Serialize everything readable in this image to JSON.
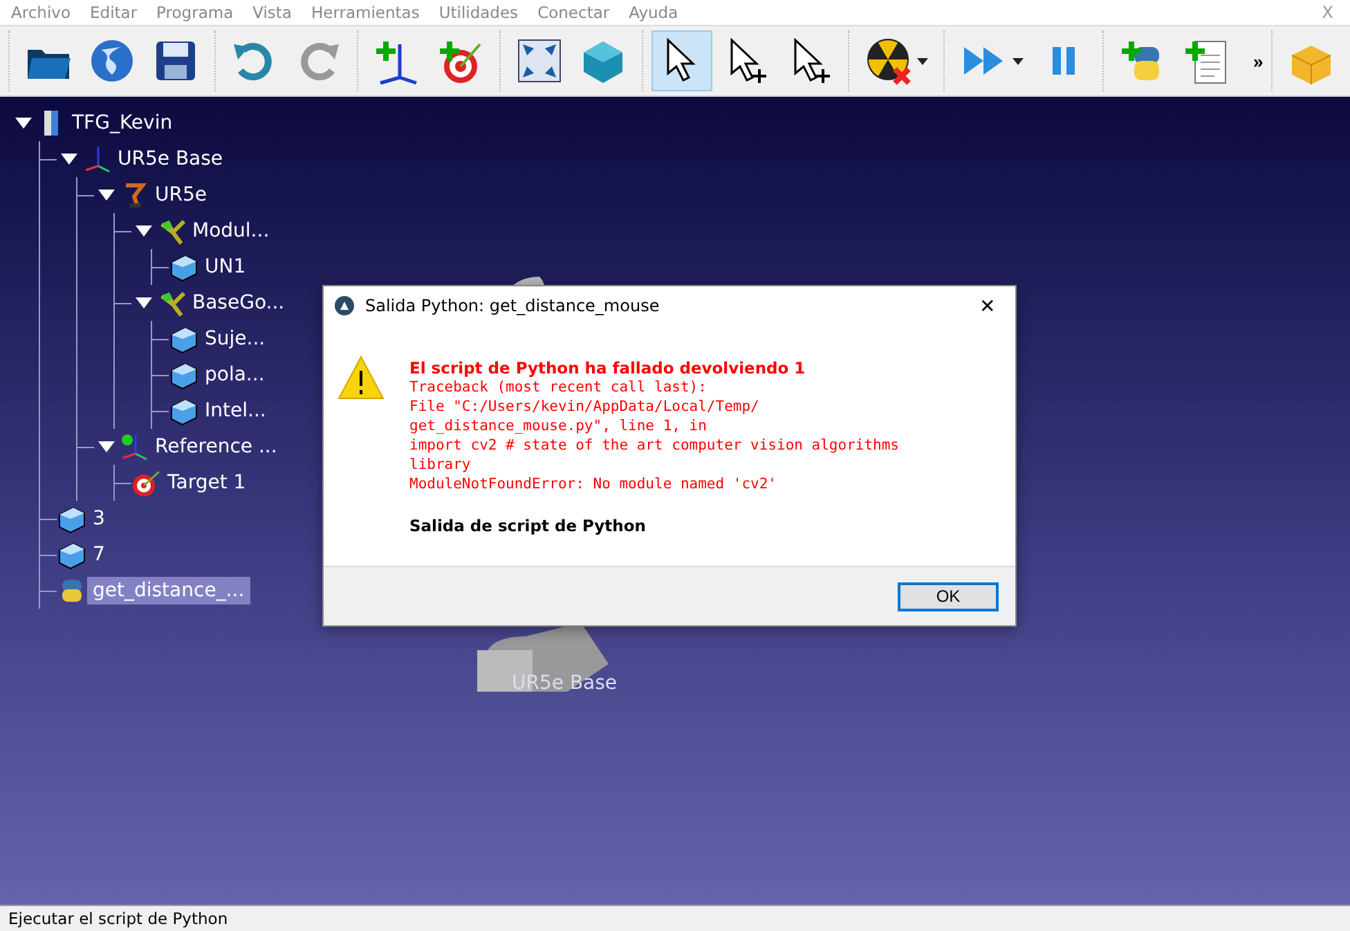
{
  "menu": [
    "Archivo",
    "Editar",
    "Programa",
    "Vista",
    "Herramientas",
    "Utilidades",
    "Conectar",
    "Ayuda"
  ],
  "close_label": "X",
  "toolbar": {
    "groups": [
      [
        {
          "kind": "open",
          "selected": false
        },
        {
          "kind": "globe",
          "selected": false
        },
        {
          "kind": "save",
          "selected": false
        }
      ],
      [
        {
          "kind": "undo",
          "selected": false
        },
        {
          "kind": "redo",
          "selected": false
        }
      ],
      [
        {
          "kind": "add-frame",
          "selected": false
        },
        {
          "kind": "add-target",
          "selected": false
        }
      ],
      [
        {
          "kind": "fit",
          "selected": false
        },
        {
          "kind": "cube",
          "selected": false
        }
      ],
      [
        {
          "kind": "pointer",
          "selected": true
        },
        {
          "kind": "pointer-move",
          "selected": false
        },
        {
          "kind": "pointer-tool",
          "selected": false
        }
      ],
      [
        {
          "kind": "radiation",
          "selected": false,
          "dropdown": true
        }
      ],
      [
        {
          "kind": "play",
          "selected": false,
          "dropdown": true
        },
        {
          "kind": "pause",
          "selected": false
        }
      ],
      [
        {
          "kind": "python-add",
          "selected": false
        },
        {
          "kind": "program-add",
          "selected": false
        }
      ]
    ],
    "overflow": "»",
    "trailing": [
      {
        "kind": "box",
        "selected": false
      }
    ]
  },
  "tree": [
    {
      "label": "TFG_Kevin",
      "kind": "station",
      "expanded": true,
      "selected": false,
      "children": [
        {
          "label": "UR5e Base",
          "kind": "frame",
          "expanded": true,
          "selected": false,
          "children": [
            {
              "label": "UR5e",
              "kind": "robot",
              "expanded": true,
              "selected": false,
              "children": [
                {
                  "label": "Modul...",
                  "kind": "tool",
                  "expanded": true,
                  "selected": false,
                  "children": [
                    {
                      "label": "UN1",
                      "kind": "object",
                      "selected": false
                    }
                  ]
                },
                {
                  "label": "BaseGo...",
                  "kind": "tool",
                  "expanded": true,
                  "selected": false,
                  "children": [
                    {
                      "label": "Suje...",
                      "kind": "object",
                      "selected": false
                    },
                    {
                      "label": "pola...",
                      "kind": "object",
                      "selected": false
                    },
                    {
                      "label": "Intel...",
                      "kind": "object",
                      "selected": false
                    }
                  ]
                }
              ]
            },
            {
              "label": "Reference ...",
              "kind": "reference",
              "expanded": true,
              "selected": false,
              "children": [
                {
                  "label": "Target 1",
                  "kind": "target",
                  "selected": false
                }
              ]
            }
          ]
        },
        {
          "label": "3",
          "kind": "object",
          "selected": false
        },
        {
          "label": "7",
          "kind": "object",
          "selected": false
        },
        {
          "label": "get_distance_...",
          "kind": "program",
          "selected": true
        }
      ]
    }
  ],
  "scene_label": "UR5e Base",
  "dialog": {
    "title": "Salida Python: get_distance_mouse",
    "close": "✕",
    "heading": "El script de Python ha fallado devolviendo 1",
    "trace": [
      "Traceback (most recent call last):",
      "File \"C:/Users/kevin/AppData/Local/Temp/",
      "get_distance_mouse.py\", line 1, in",
      "import cv2 # state of the art computer vision algorithms",
      "library",
      "ModuleNotFoundError: No module named 'cv2'"
    ],
    "footer_text": "Salida de script de Python",
    "button": "OK"
  },
  "status_bar": "Ejecutar el script de Python"
}
